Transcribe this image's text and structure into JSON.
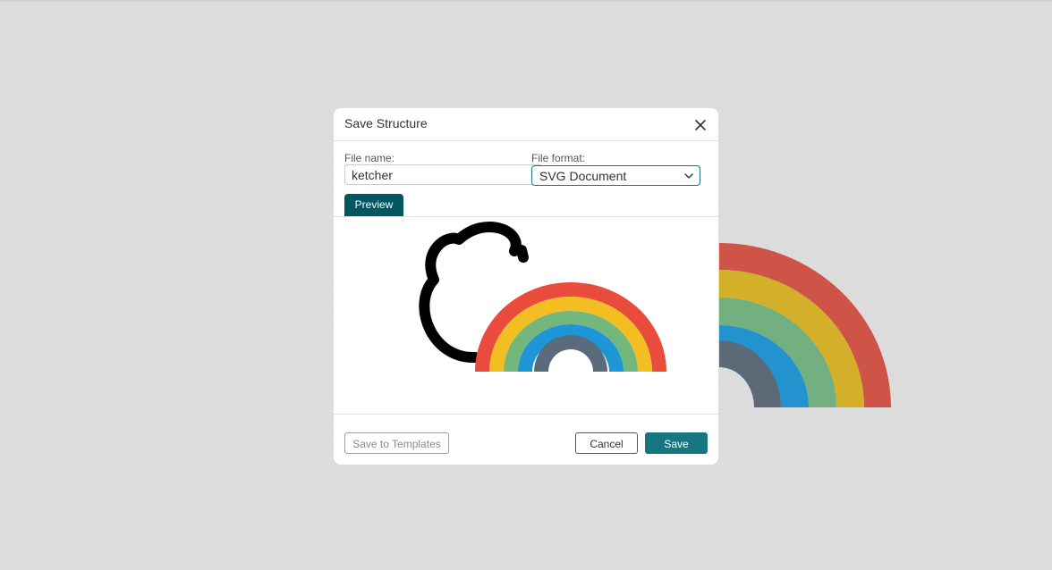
{
  "dialog": {
    "title": "Save Structure",
    "close_icon": "close-icon"
  },
  "file_name": {
    "label": "File name:",
    "value": "ketcher"
  },
  "file_format": {
    "label": "File format:",
    "selected": "SVG Document",
    "icon": "chevron-down-icon"
  },
  "tabs": {
    "preview_label": "Preview"
  },
  "preview": {
    "content": "cloud-and-rainbow-image"
  },
  "footer": {
    "save_to_templates_label": "Save to Templates",
    "cancel_label": "Cancel",
    "save_label": "Save"
  },
  "colors": {
    "accent": "#167782",
    "tab_active": "#005662",
    "rainbow": [
      "#e94b3c",
      "#f2be22",
      "#74b77d",
      "#1e95d6",
      "#5a6b7b"
    ],
    "background_rainbow": [
      "#cd5446",
      "#d4af2a",
      "#74b07f",
      "#2393cf",
      "#5c6a78"
    ]
  }
}
